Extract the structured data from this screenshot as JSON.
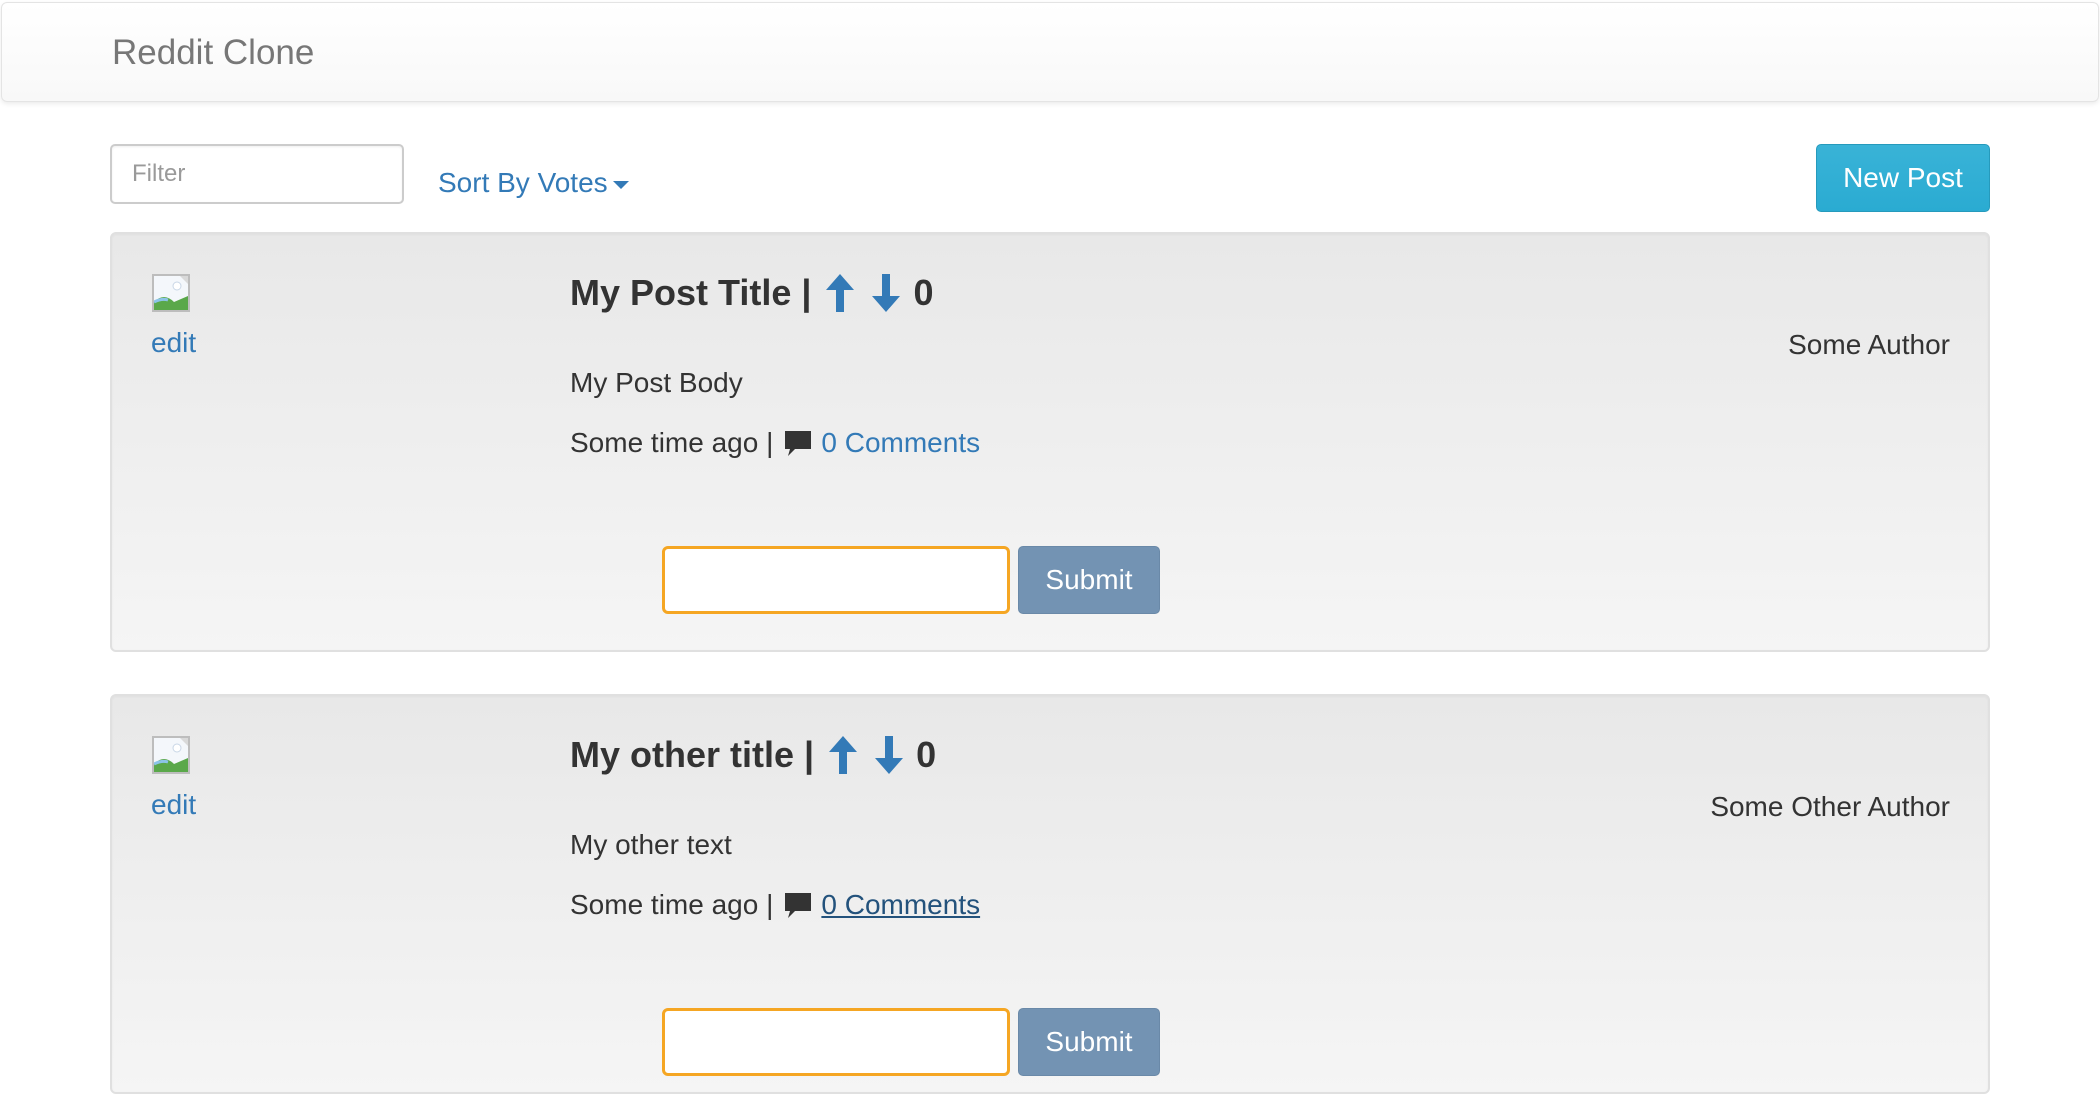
{
  "navbar": {
    "brand": "Reddit Clone"
  },
  "toolbar": {
    "filter_placeholder": "Filter",
    "filter_value": "",
    "sort_label": "Sort By Votes",
    "new_post_label": "New Post"
  },
  "posts": [
    {
      "title": "My Post Title |",
      "votes": "0",
      "author": "Some Author",
      "body": "My Post Body",
      "time": "Some time ago |",
      "comments_label": "0 Comments",
      "edit_label": "edit",
      "comment_value": "",
      "submit_label": "Submit"
    },
    {
      "title": "My other title |",
      "votes": "0",
      "author": "Some Other Author",
      "body": "My other text",
      "time": "Some time ago |",
      "comments_label": "0 Comments",
      "edit_label": "edit",
      "comment_value": "",
      "submit_label": "Submit"
    }
  ],
  "icons": {
    "vote_up": "arrow-up-icon",
    "vote_down": "arrow-down-icon",
    "comment": "comment-icon",
    "thumbnail": "broken-image-icon"
  },
  "colors": {
    "link": "#337ab7",
    "new_post_button": "#31b0d5",
    "submit_button": "#7393b3",
    "comment_input_border": "#f5a623",
    "brand_text": "#777777"
  }
}
